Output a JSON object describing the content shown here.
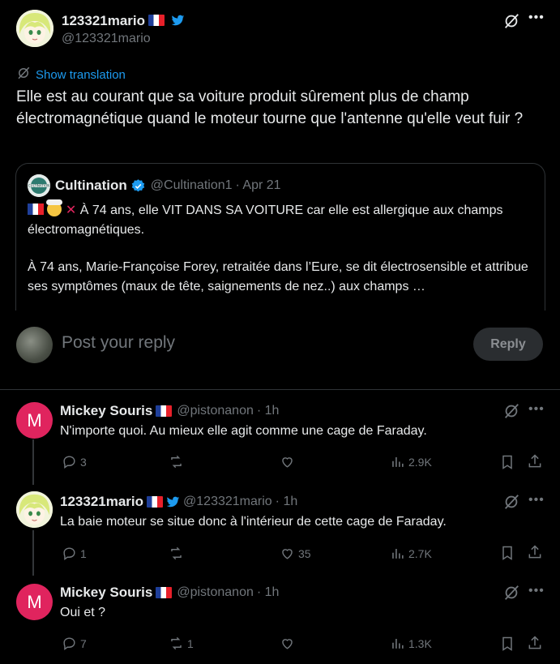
{
  "main_post": {
    "display_name": "123321mario",
    "handle": "@123321mario",
    "show_translation": "Show translation",
    "text": "Elle est au courant que sa voiture produit sûrement plus de champ électromagnétique quand le moteur tourne que l'antenne qu'elle veut fuir ?"
  },
  "quote": {
    "display_name": "Cultination",
    "handle": "@Cultination1",
    "date": "· Apr 21",
    "line1": "À 74 ans, elle VIT DANS SA VOITURE car elle est allergique aux champs électromagnétiques.",
    "line2": "À 74 ans, Marie-Françoise Forey, retraitée dans l’Eure, se dit électrosensible et attribue ses symptômes (maux de tête, saignements de nez..) aux champs …"
  },
  "composer": {
    "placeholder": "Post your reply",
    "reply_label": "Reply"
  },
  "replies": [
    {
      "display_name": "Mickey Souris",
      "handle": "@pistonanon",
      "time": "· 1h",
      "avatar_letter": "M",
      "text": "N'importe quoi. Au mieux elle agit comme une cage de Faraday.",
      "replies": "3",
      "reposts": "",
      "likes": "",
      "views": "2.9K"
    },
    {
      "display_name": "123321mario",
      "handle": "@123321mario",
      "time": "· 1h",
      "text": "La baie moteur se situe donc à l'intérieur de cette cage de Faraday.",
      "replies": "1",
      "reposts": "",
      "likes": "35",
      "views": "2.7K"
    },
    {
      "display_name": "Mickey Souris",
      "handle": "@pistonanon",
      "time": "· 1h",
      "avatar_letter": "M",
      "text": "Oui et ?",
      "replies": "7",
      "reposts": "1",
      "likes": "",
      "views": "1.3K"
    }
  ],
  "icons": [
    "grok-icon",
    "more-icon",
    "twitter-bird-icon",
    "verified-badge-icon",
    "reply-icon",
    "repost-icon",
    "like-icon",
    "views-icon",
    "bookmark-icon",
    "share-icon",
    "translate-icon"
  ],
  "colors": {
    "background": "#000000",
    "text": "#e7e9ea",
    "muted": "#71767b",
    "link": "#1d9bf0",
    "border": "#2f3336",
    "avatar_m": "#e0245e"
  }
}
